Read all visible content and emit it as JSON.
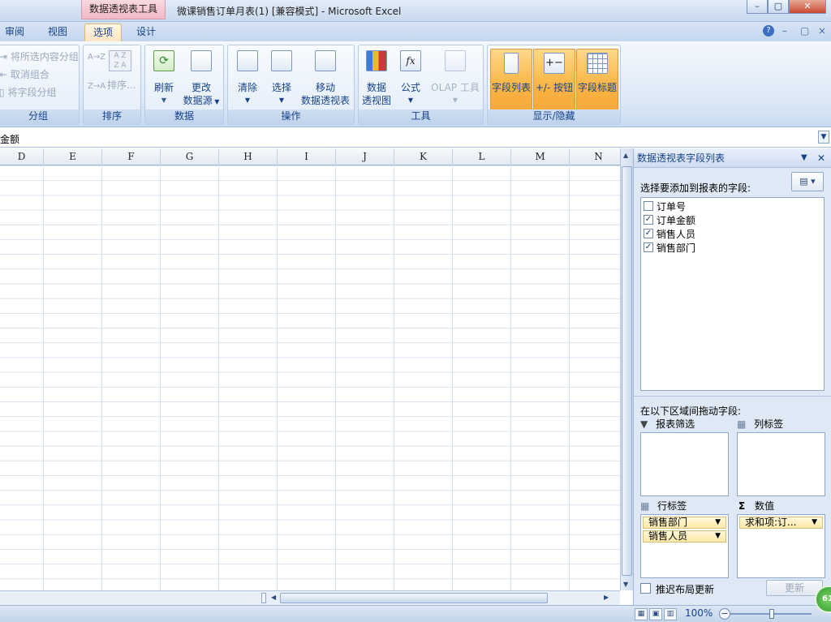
{
  "window": {
    "context_tab": "数据透视表工具",
    "title": "微课销售订单月表(1)  [兼容模式] - Microsoft Excel",
    "controls": {
      "minimize": "–",
      "restore": "▢",
      "close": "✕"
    }
  },
  "ribbon_tabs": [
    {
      "label": "审阅",
      "active": false
    },
    {
      "label": "视图",
      "active": false
    },
    {
      "label": "选项",
      "active": true
    },
    {
      "label": "设计",
      "active": false
    }
  ],
  "ribbon_controls": {
    "help": "?",
    "minimize": "–",
    "restore": "▢",
    "close": "×"
  },
  "groups": {
    "group": {
      "label": "分组",
      "items": [
        "将所选内容分组",
        "取消组合",
        "将字段分组"
      ]
    },
    "sort": {
      "label": "排序",
      "asc": "A→Z",
      "desc": "Z→A",
      "sort_button": "排序..."
    },
    "data": {
      "label": "数据",
      "refresh": "刷新",
      "change_source_1": "更改",
      "change_source_2": "数据源"
    },
    "actions": {
      "label": "操作",
      "clear": "清除",
      "select": "选择",
      "move_1": "移动",
      "move_2": "数据透视表"
    },
    "tools": {
      "label": "工具",
      "pivotchart_1": "数据",
      "pivotchart_2": "透视图",
      "formula": "公式",
      "olap": "OLAP 工具"
    },
    "show_hide": {
      "label": "显示/隐藏",
      "field_list": "字段列表",
      "buttons": "+/- 按钮",
      "headers": "字段标题"
    }
  },
  "formula_bar": {
    "content": "金额"
  },
  "columns": [
    "D",
    "E",
    "F",
    "G",
    "H",
    "I",
    "J",
    "K",
    "L",
    "M",
    "N"
  ],
  "pivot_pane": {
    "title": "数据透视表字段列表",
    "choose_label": "选择要添加到报表的字段:",
    "fields": [
      {
        "name": "订单号",
        "checked": false
      },
      {
        "name": "订单金额",
        "checked": true
      },
      {
        "name": "销售人员",
        "checked": true
      },
      {
        "name": "销售部门",
        "checked": true
      }
    ],
    "drag_label": "在以下区域间拖动字段:",
    "report_filter": "报表筛选",
    "column_labels": "列标签",
    "row_labels": "行标签",
    "values": "数值",
    "row_items": [
      "销售部门",
      "销售人员"
    ],
    "value_items": [
      "求和项:订..."
    ],
    "defer_label": "推迟布局更新",
    "update_button": "更新"
  },
  "status": {
    "zoom": "100%"
  },
  "badge": "61"
}
